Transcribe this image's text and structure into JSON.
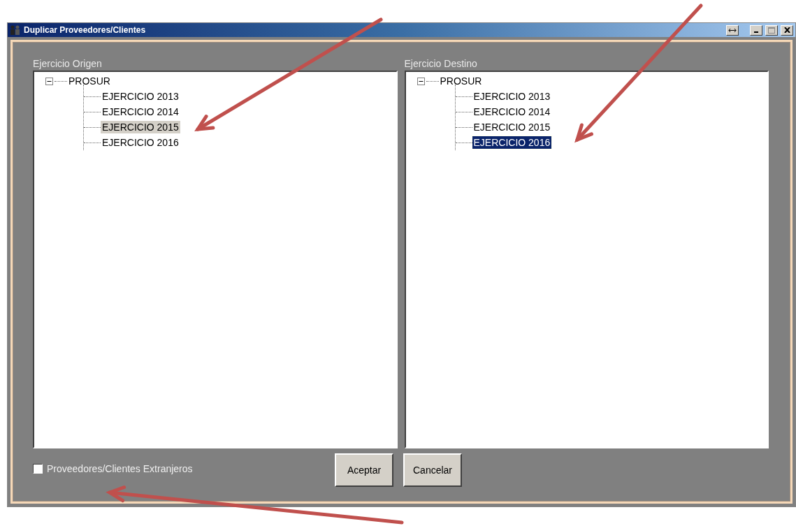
{
  "window": {
    "title": "Duplicar Proveedores/Clientes"
  },
  "panels": [
    {
      "label": "Ejercicio Origen",
      "focused": false,
      "tree": [
        {
          "label": "PROSUR",
          "expanded": true,
          "selected": false,
          "children": [
            {
              "label": "EJERCICIO 2013",
              "selected": false
            },
            {
              "label": "EJERCICIO 2014",
              "selected": false
            },
            {
              "label": "EJERCICIO 2015",
              "selected": true
            },
            {
              "label": "EJERCICIO 2016",
              "selected": false
            }
          ]
        }
      ]
    },
    {
      "label": "Ejercicio Destino",
      "focused": true,
      "tree": [
        {
          "label": "PROSUR",
          "expanded": true,
          "selected": false,
          "children": [
            {
              "label": "EJERCICIO 2013",
              "selected": false
            },
            {
              "label": "EJERCICIO 2014",
              "selected": false
            },
            {
              "label": "EJERCICIO 2015",
              "selected": false
            },
            {
              "label": "EJERCICIO 2016",
              "selected": true
            }
          ]
        }
      ]
    }
  ],
  "checkbox": {
    "label": "Proveedores/Clientes Extranjeros",
    "checked": false
  },
  "buttons": [
    "Aceptar",
    "Cancelar"
  ]
}
